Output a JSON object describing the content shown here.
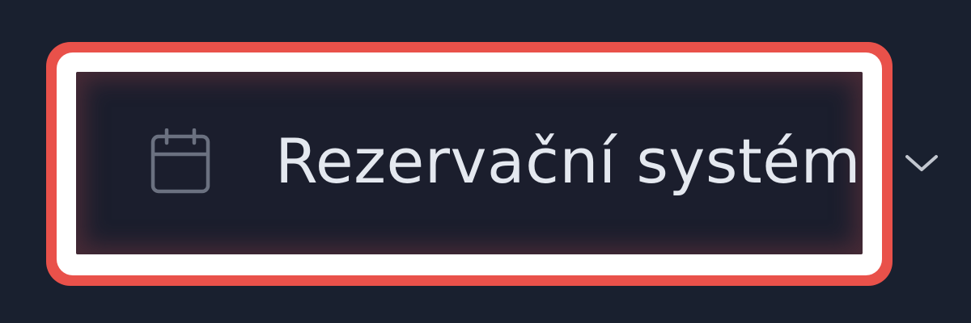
{
  "sidebar": {
    "item": {
      "label": "Rezervační systém",
      "icon": "calendar-icon",
      "toggle_icon": "chevron-down-icon",
      "expanded": false,
      "highlighted": true
    }
  },
  "colors": {
    "background": "#19202f",
    "item_background": "#1b1e2d",
    "highlight_outer": "#e9514a",
    "highlight_inner": "#ffffff",
    "text": "#e4e8ef",
    "icon": "#6b7180",
    "chevron": "#c2c7d0"
  }
}
